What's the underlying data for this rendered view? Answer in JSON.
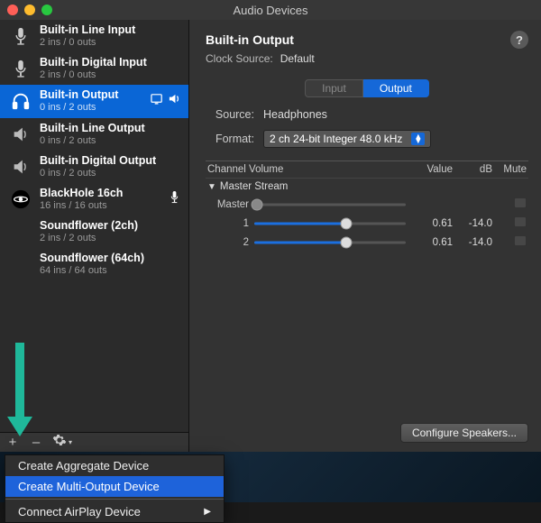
{
  "window": {
    "title": "Audio Devices"
  },
  "sidebar": {
    "devices": [
      {
        "name": "Built-in Line Input",
        "sub": "2 ins / 0 outs",
        "icon": "mic",
        "selected": false
      },
      {
        "name": "Built-in Digital Input",
        "sub": "2 ins / 0 outs",
        "icon": "mic",
        "selected": false
      },
      {
        "name": "Built-in Output",
        "sub": "0 ins / 2 outs",
        "icon": "headphones",
        "selected": true,
        "badges": [
          "screen",
          "speaker"
        ]
      },
      {
        "name": "Built-in Line Output",
        "sub": "0 ins / 2 outs",
        "icon": "speaker",
        "selected": false
      },
      {
        "name": "Built-in Digital Output",
        "sub": "0 ins / 2 outs",
        "icon": "speaker",
        "selected": false
      },
      {
        "name": "BlackHole 16ch",
        "sub": "16 ins / 16 outs",
        "icon": "blackhole",
        "selected": false,
        "badges": [
          "input-mic"
        ]
      },
      {
        "name": "Soundflower (2ch)",
        "sub": "2 ins / 2 outs",
        "icon": "none",
        "selected": false
      },
      {
        "name": "Soundflower (64ch)",
        "sub": "64 ins / 64 outs",
        "icon": "none",
        "selected": false
      }
    ],
    "footer": {
      "plus": "+",
      "minus": "–"
    }
  },
  "main": {
    "title": "Built-in Output",
    "help": "?",
    "clock_label": "Clock Source:",
    "clock_value": "Default",
    "tabs": {
      "input": "Input",
      "output": "Output",
      "active": "output"
    },
    "source_label": "Source:",
    "source_value": "Headphones",
    "format_label": "Format:",
    "format_value": "2 ch 24-bit Integer 48.0 kHz",
    "table": {
      "headers": {
        "channel": "Channel Volume",
        "value": "Value",
        "db": "dB",
        "mute": "Mute"
      },
      "stream": "Master Stream",
      "rows": [
        {
          "name": "Master",
          "value": "",
          "db": "",
          "fill": 0.02,
          "disabled": true
        },
        {
          "name": "1",
          "value": "0.61",
          "db": "-14.0",
          "fill": 0.61
        },
        {
          "name": "2",
          "value": "0.61",
          "db": "-14.0",
          "fill": 0.61
        }
      ]
    },
    "configure": "Configure Speakers..."
  },
  "context_menu": {
    "items": [
      {
        "label": "Create Aggregate Device",
        "selected": false
      },
      {
        "label": "Create Multi-Output Device",
        "selected": true
      }
    ],
    "sep_then": {
      "label": "Connect AirPlay Device",
      "submenu": true
    }
  }
}
